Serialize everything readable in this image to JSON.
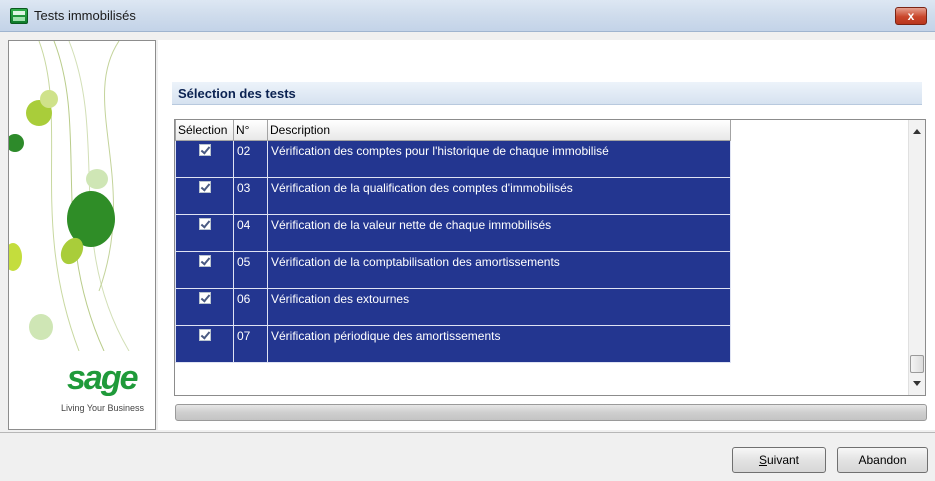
{
  "window": {
    "title": "Tests immobilisés",
    "close_label": "x"
  },
  "brand": {
    "logo": "sage",
    "tagline": "Living Your Business"
  },
  "section": {
    "title": "Sélection des tests"
  },
  "grid": {
    "columns": [
      "Sélection",
      "N°",
      "Description"
    ],
    "rows": [
      {
        "selected": true,
        "num": "02",
        "description": "Vérification des comptes pour l'historique de chaque immobilisé"
      },
      {
        "selected": true,
        "num": "03",
        "description": "Vérification de la qualification des comptes d'immobilisés"
      },
      {
        "selected": true,
        "num": "04",
        "description": "Vérification de la valeur nette de chaque immobilisés"
      },
      {
        "selected": true,
        "num": "05",
        "description": "Vérification de la comptabilisation des amortissements"
      },
      {
        "selected": true,
        "num": "06",
        "description": "Vérification des extournes"
      },
      {
        "selected": true,
        "num": "07",
        "description": "Vérification périodique des amortissements"
      }
    ],
    "selection_color": "#233690"
  },
  "progress": {
    "value": 0
  },
  "buttons": {
    "next_first": "S",
    "next_rest": "uivant",
    "cancel": "Abandon"
  }
}
